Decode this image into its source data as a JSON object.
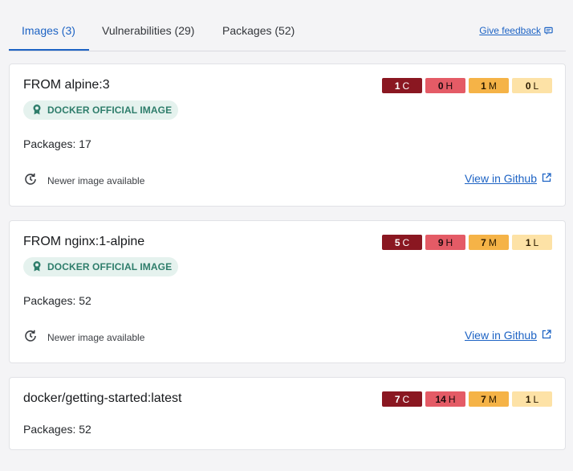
{
  "tabs": [
    {
      "label": "Images (3)",
      "active": true
    },
    {
      "label": "Vulnerabilities (29)",
      "active": false
    },
    {
      "label": "Packages (52)",
      "active": false
    }
  ],
  "feedback": {
    "label": "Give feedback",
    "icon": "feedback-icon"
  },
  "colors": {
    "accent": "#1d63c4",
    "critical": "#8a1721",
    "high": "#e45b66",
    "medium": "#f5b347",
    "low": "#fde2a6",
    "official_badge_bg": "#e5f2ee",
    "official_badge_text": "#2e7d6b"
  },
  "images": [
    {
      "title": "FROM alpine:3",
      "severity": {
        "c": "1",
        "h": "0",
        "m": "1",
        "l": "0"
      },
      "severity_letters": {
        "c": "C",
        "h": "H",
        "m": "M",
        "l": "L"
      },
      "badge": "DOCKER OFFICIAL IMAGE",
      "packages": "Packages: 17",
      "newer": "Newer image available",
      "github": "View in Github"
    },
    {
      "title": "FROM nginx:1-alpine",
      "severity": {
        "c": "5",
        "h": "9",
        "m": "7",
        "l": "1"
      },
      "severity_letters": {
        "c": "C",
        "h": "H",
        "m": "M",
        "l": "L"
      },
      "badge": "DOCKER OFFICIAL IMAGE",
      "packages": "Packages: 52",
      "newer": "Newer image available",
      "github": "View in Github"
    },
    {
      "title": "docker/getting-started:latest",
      "severity": {
        "c": "7",
        "h": "14",
        "m": "7",
        "l": "1"
      },
      "severity_letters": {
        "c": "C",
        "h": "H",
        "m": "M",
        "l": "L"
      },
      "packages": "Packages: 52"
    }
  ]
}
